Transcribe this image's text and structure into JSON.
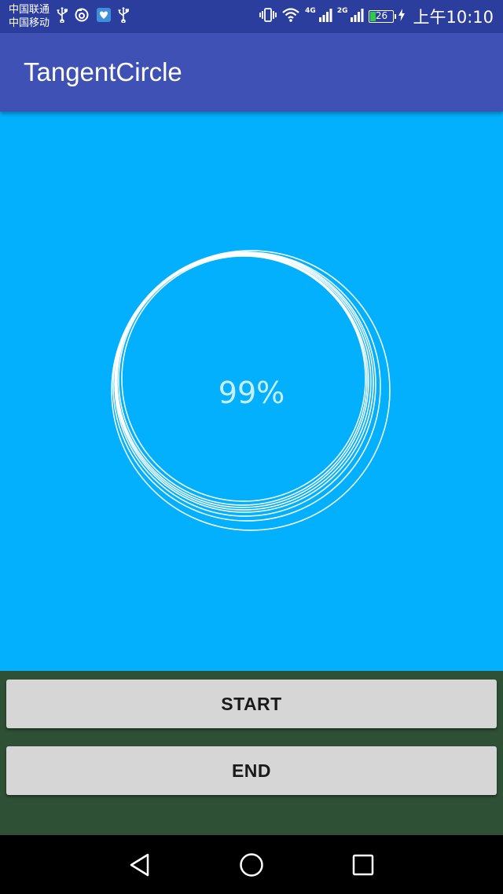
{
  "status_bar": {
    "carrier_1": "中国联通",
    "carrier_2": "中国移动",
    "left_icons": [
      "usb-icon",
      "sync-icon",
      "heart-app-icon",
      "usb-icon"
    ],
    "right_icons": [
      "vibrate-icon",
      "wifi-icon",
      "signal-4g-icon",
      "signal-2g-icon",
      "battery-icon",
      "charging-icon"
    ],
    "network_1": "4G",
    "network_2": "2G",
    "battery_level": "26",
    "battery_fraction": 0.26,
    "time": "上午10:10"
  },
  "app_bar": {
    "title": "TangentCircle"
  },
  "content": {
    "progress_text": "99%",
    "background_color": "#03B0FE",
    "circle_color": "#FFFFFF"
  },
  "buttons": {
    "start_label": "START",
    "end_label": "END"
  },
  "nav_bar": {
    "icons": [
      "back-icon",
      "home-icon",
      "recents-icon"
    ]
  },
  "colors": {
    "status_bar": "#2B3E9E",
    "app_bar": "#3F51B5",
    "button_panel": "#2E5035",
    "button": "#D6D6D6",
    "nav_bar": "#000000"
  }
}
